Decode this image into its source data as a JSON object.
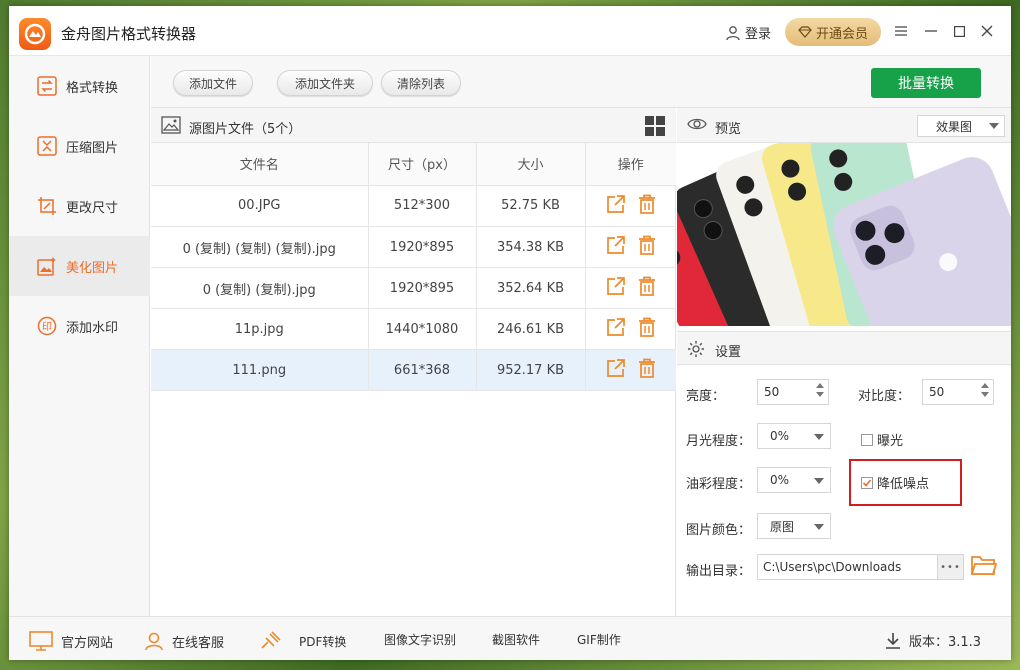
{
  "app": {
    "title": "金舟图片格式转换器"
  },
  "header": {
    "login_label": "登录",
    "vip_label": "开通会员"
  },
  "sidebar": {
    "items": [
      {
        "label": "格式转换"
      },
      {
        "label": "压缩图片"
      },
      {
        "label": "更改尺寸"
      },
      {
        "label": "美化图片"
      },
      {
        "label": "添加水印"
      }
    ],
    "active_index": 3
  },
  "toolbar": {
    "add_file": "添加文件",
    "add_folder": "添加文件夹",
    "clear_list": "清除列表",
    "batch_convert": "批量转换"
  },
  "file_panel": {
    "title": "源图片文件（5个）",
    "columns": [
      "文件名",
      "尺寸（px）",
      "大小",
      "操作"
    ],
    "rows": [
      {
        "name": "00.JPG",
        "size": "512*300",
        "filesize": "52.75 KB"
      },
      {
        "name": "0 (复制) (复制) (复制).jpg",
        "size": "1920*895",
        "filesize": "354.38 KB"
      },
      {
        "name": "0 (复制) (复制).jpg",
        "size": "1920*895",
        "filesize": "352.64 KB"
      },
      {
        "name": "11p.jpg",
        "size": "1440*1080",
        "filesize": "246.61 KB"
      },
      {
        "name": "111.png",
        "size": "661*368",
        "filesize": "952.17 KB"
      }
    ],
    "selected_row": 4
  },
  "preview": {
    "title": "预览",
    "mode": "效果图"
  },
  "settings": {
    "title": "设置",
    "brightness_label": "亮度：",
    "brightness_value": "50",
    "contrast_label": "对比度：",
    "contrast_value": "50",
    "moonlight_label": "月光程度：",
    "moonlight_value": "0%",
    "exposure_label": "曝光",
    "exposure_checked": false,
    "oil_label": "油彩程度：",
    "oil_value": "0%",
    "denoise_label": "降低噪点",
    "denoise_checked": true,
    "color_label": "图片颜色：",
    "color_value": "原图",
    "output_label": "输出目录：",
    "output_path": "C:\\Users\\pc\\Downloads",
    "dots": "•••"
  },
  "footer": {
    "site": "官方网站",
    "service": "在线客服",
    "pdf": "PDF转换",
    "ocr": "图像文字识别",
    "screenshot": "截图软件",
    "gif": "GIF制作",
    "version": "版本：3.1.3"
  },
  "colors": {
    "accent": "#ed6d2b",
    "primary_button": "#17a24a",
    "highlight_border": "#d21e1e",
    "selected_row": "#e6f1fb"
  }
}
